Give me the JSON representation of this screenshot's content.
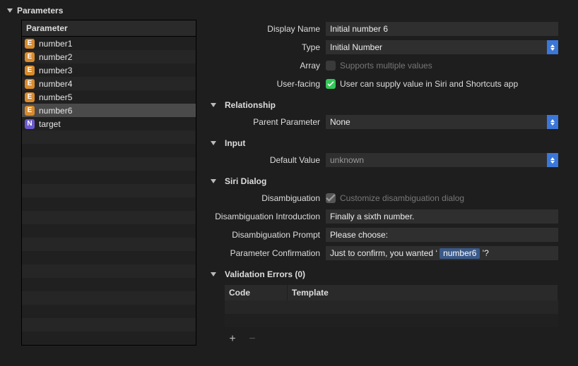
{
  "header": {
    "title": "Parameters"
  },
  "left": {
    "columnHeader": "Parameter",
    "items": [
      {
        "badge": "E",
        "kind": "enum",
        "name": "number1"
      },
      {
        "badge": "E",
        "kind": "enum",
        "name": "number2"
      },
      {
        "badge": "E",
        "kind": "enum",
        "name": "number3"
      },
      {
        "badge": "E",
        "kind": "enum",
        "name": "number4"
      },
      {
        "badge": "E",
        "kind": "enum",
        "name": "number5"
      },
      {
        "badge": "E",
        "kind": "enum",
        "name": "number6"
      },
      {
        "badge": "N",
        "kind": "number",
        "name": "target"
      }
    ],
    "selectedIndex": 5
  },
  "form": {
    "displayName": {
      "label": "Display Name",
      "value": "Initial number 6"
    },
    "type": {
      "label": "Type",
      "value": "Initial Number"
    },
    "array": {
      "label": "Array",
      "checkbox": false,
      "text": "Supports multiple values"
    },
    "userFacing": {
      "label": "User-facing",
      "checkbox": true,
      "text": "User can supply value in Siri and Shortcuts app"
    },
    "sections": {
      "relationship": "Relationship",
      "input": "Input",
      "siri": "Siri Dialog",
      "validation": "Validation Errors (0)"
    },
    "parentParameter": {
      "label": "Parent Parameter",
      "value": "None"
    },
    "defaultValue": {
      "label": "Default Value",
      "value": "unknown"
    },
    "disambiguation": {
      "label": "Disambiguation",
      "checkbox": true,
      "text": "Customize disambiguation dialog"
    },
    "introduction": {
      "label": "Disambiguation Introduction",
      "value": "Finally a sixth number."
    },
    "prompt": {
      "label": "Disambiguation Prompt",
      "value": "Please choose:"
    },
    "confirmation": {
      "label": "Parameter Confirmation",
      "prefix": "Just to confirm, you wanted ‘",
      "token": "number6",
      "suffix": "’?"
    },
    "validationTable": {
      "headers": {
        "code": "Code",
        "template": "Template"
      }
    }
  }
}
